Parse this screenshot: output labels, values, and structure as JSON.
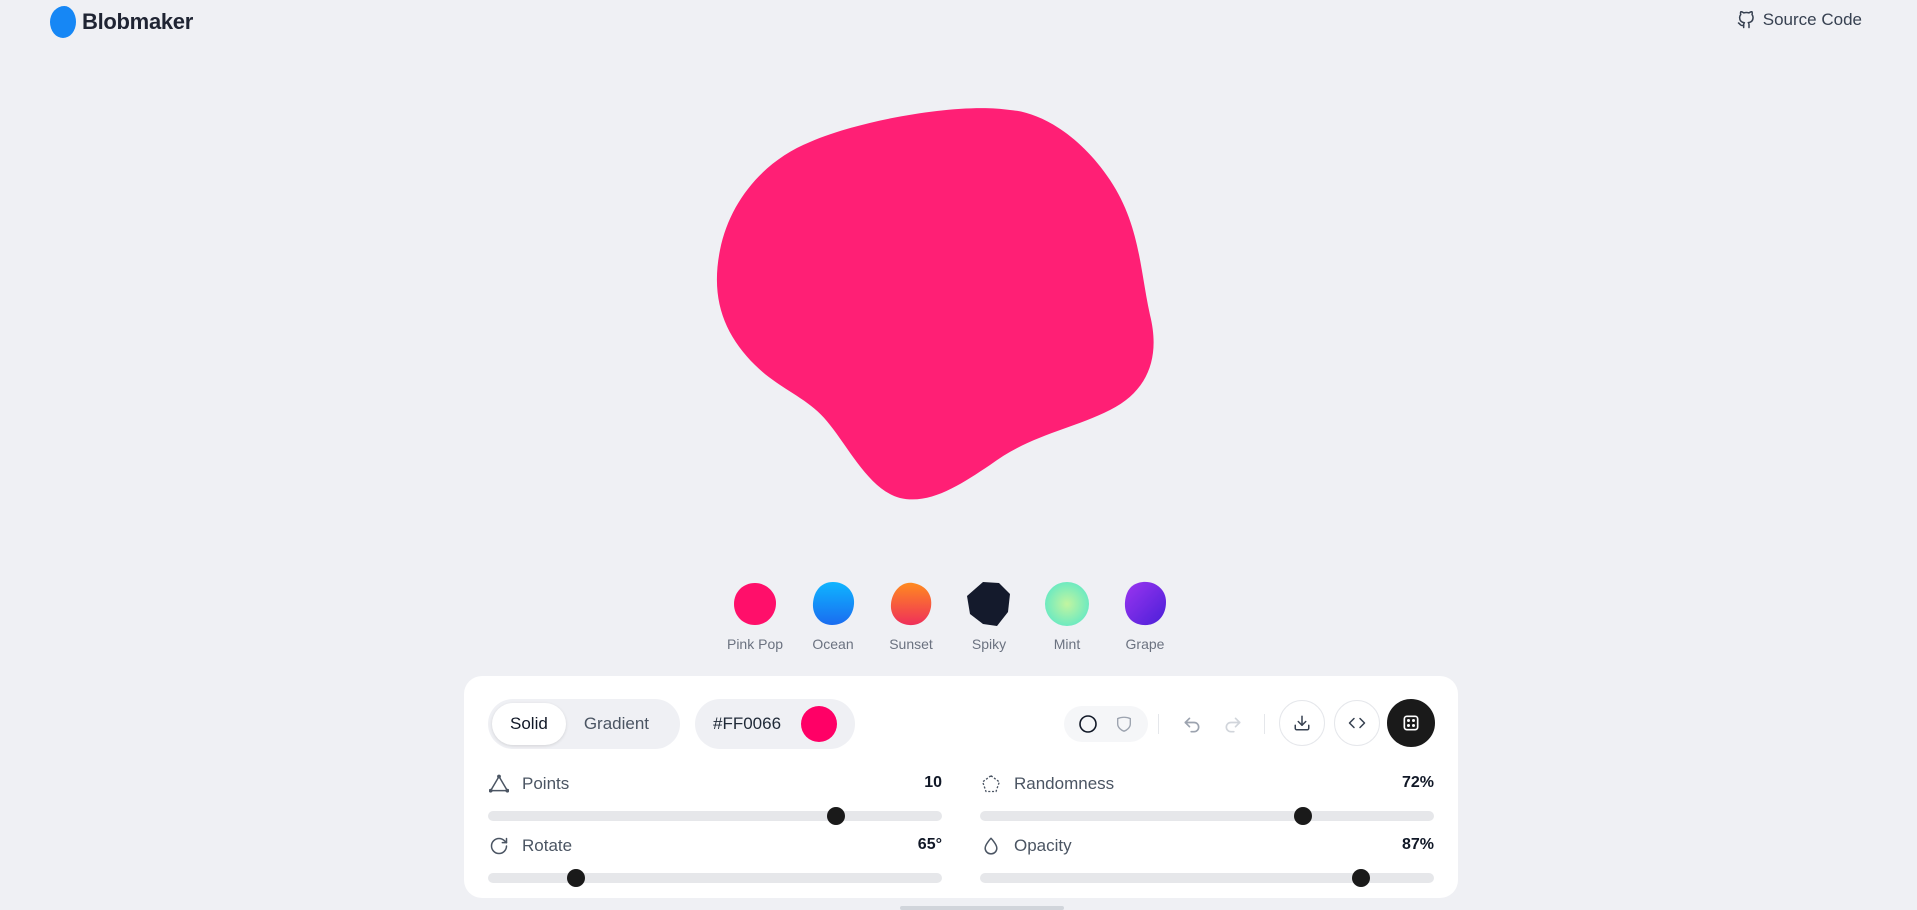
{
  "header": {
    "logo_text": "Blobmaker",
    "source_label": "Source Code",
    "brand_color": "#1687f5"
  },
  "blob": {
    "fill": "#ff1f75"
  },
  "presets": [
    {
      "label": "Pink Pop",
      "color": "#ff0f6a"
    },
    {
      "label": "Ocean",
      "color": "#1a8cf5"
    },
    {
      "label": "Sunset",
      "color": "#f55a3a"
    },
    {
      "label": "Spiky",
      "color": "#141a2c"
    },
    {
      "label": "Mint",
      "color": "#7fe8b0"
    },
    {
      "label": "Grape",
      "color": "#6a1fe0"
    }
  ],
  "controls": {
    "fill_modes": [
      "Solid",
      "Gradient"
    ],
    "active_mode": "Solid",
    "color_hex": "#FF0066",
    "color_value": "#ff0066"
  },
  "sliders": {
    "points": {
      "label": "Points",
      "display": "10",
      "fraction": 0.766
    },
    "randomness": {
      "label": "Randomness",
      "display": "72%",
      "fraction": 0.712
    },
    "rotate": {
      "label": "Rotate",
      "display": "65°",
      "fraction": 0.193
    },
    "opacity": {
      "label": "Opacity",
      "display": "87%",
      "fraction": 0.84
    }
  }
}
